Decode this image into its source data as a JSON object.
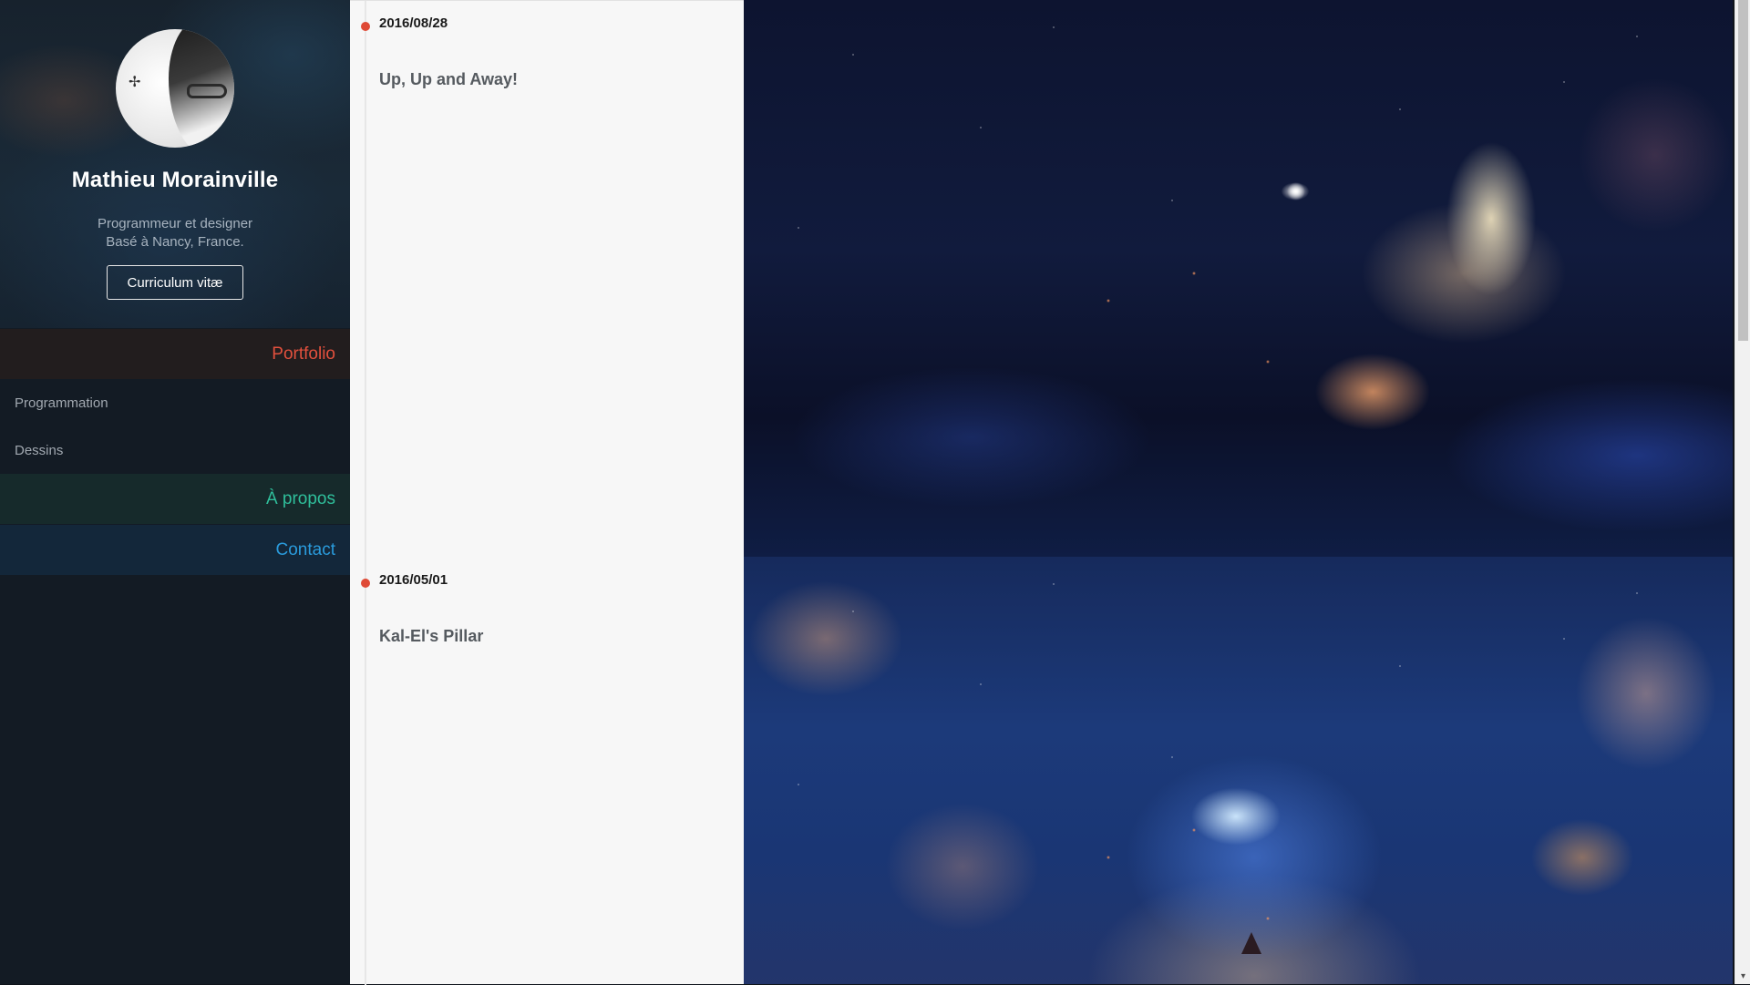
{
  "profile": {
    "name": "Mathieu Morainville",
    "tagline_line1": "Programmeur et designer",
    "tagline_line2": "Basé à Nancy, France.",
    "cv_button": "Curriculum vitæ"
  },
  "nav": {
    "portfolio": "Portfolio",
    "programmation": "Programmation",
    "dessins": "Dessins",
    "apropos": "À propos",
    "contact": "Contact"
  },
  "posts": [
    {
      "date": "2016/08/28",
      "title": "Up, Up and Away!"
    },
    {
      "date": "2016/05/01",
      "title": "Kal-El's Pillar"
    }
  ],
  "colors": {
    "portfolio_accent": "#e2503d",
    "apropos_accent": "#2fbf9b",
    "contact_accent": "#2a9bdc",
    "timeline_dot": "#df4a36"
  },
  "icons": {
    "scroll_down": "▾"
  }
}
